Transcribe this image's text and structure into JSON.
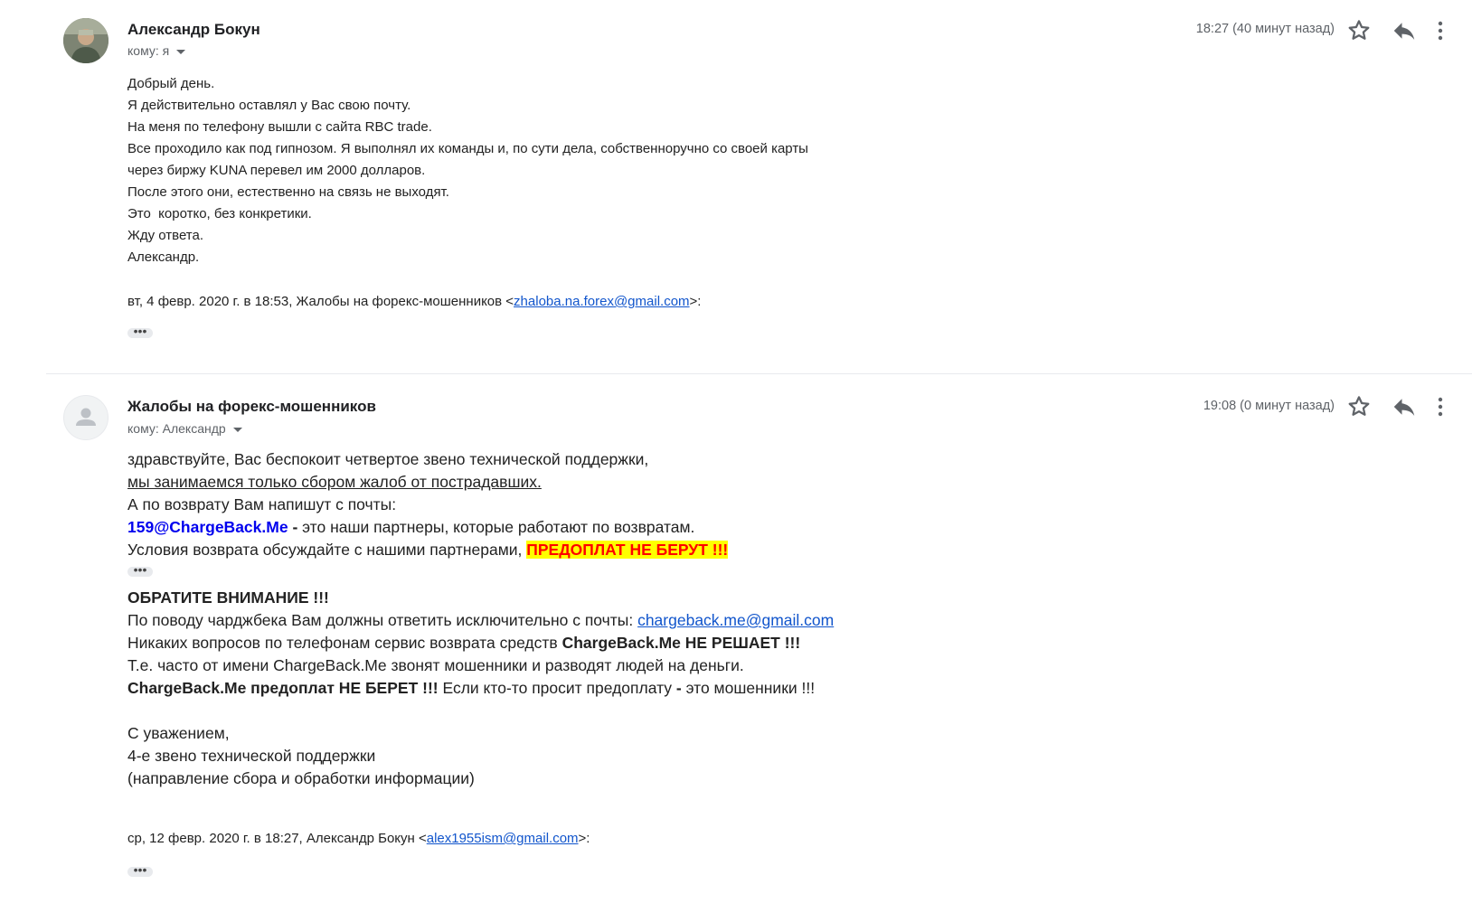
{
  "message1": {
    "sender": "Александр Бокун",
    "to_label": "кому: я",
    "time": "18:27 (40 минут назад)",
    "body_lines": [
      "Добрый день.",
      "Я действительно оставлял у Вас свою почту.",
      "На меня по телефону вышли с сайта RBC trade.",
      "Все проходило как под гипнозом. Я выполнял их команды и, по сути дела, собственноручно со своей карты",
      "через биржу KUNA перевел им 2000 долларов.",
      "После этого они, естественно на связь не выходят.",
      "Это  коротко, без конкретики.",
      "Жду ответа.",
      "Александр."
    ],
    "quote_prefix": "вт, 4 февр. 2020 г. в 18:53, Жалобы на форекс-мошенников <",
    "quote_email": "zhaloba.na.forex@gmail.com",
    "quote_suffix": ">:",
    "dots": "•••"
  },
  "message2": {
    "sender": "Жалобы на форекс-мошенников",
    "to_label": "кому: Александр",
    "time": "19:08 (0 минут назад)",
    "line1": "здравствуйте, Вас беспокоит четвертое звено технической поддержки,",
    "line2": "мы занимаемся только сбором жалоб от пострадавших.",
    "line3": "А по возврату Вам напишут с почты:",
    "line4_email": "159@ChargeBack.Me",
    "line4_rest_bold": " - ",
    "line4_rest": "это наши партнеры, которые работают по возвратам.",
    "line5_text": "Условия возврата обсуждайте с нашими партнерами, ",
    "line5_highlight": "ПРЕДОПЛАТ НЕ БЕРУТ !!!",
    "dots": "•••",
    "attention": "ОБРАТИТЕ ВНИМАНИЕ !!!",
    "line7_text": "По поводу чарджбека Вам должны ответить исключительно с почты: ",
    "line7_email": "chargeback.me@gmail.com",
    "line8_text": "Никаких вопросов по телефонам сервис возврата средств ",
    "line8_bold": "ChargeBack.Me НЕ РЕШАЕТ !!!",
    "line9": "Т.е. часто от имени ChargeBack.Me звонят мошенники и разводят людей на деньги.",
    "line10_bold": "ChargeBack.Me предоплат НЕ БЕРЕТ !!!",
    "line10_text1": " Если кто-то просит предоплату ",
    "line10_dash": "-",
    "line10_text2": " это мошенники !!!",
    "sign1": "С уважением,",
    "sign2": "4-е звено технической поддержки",
    "sign3": "(направление сбора и обработки информации)",
    "quote_prefix": "ср, 12 февр. 2020 г. в 18:27, Александр Бокун <",
    "quote_email": "alex1955ism@gmail.com",
    "quote_suffix": ">:",
    "dots2": "•••"
  },
  "icons": [
    "star-icon",
    "reply-icon",
    "more-vert-icon",
    "person-icon"
  ]
}
